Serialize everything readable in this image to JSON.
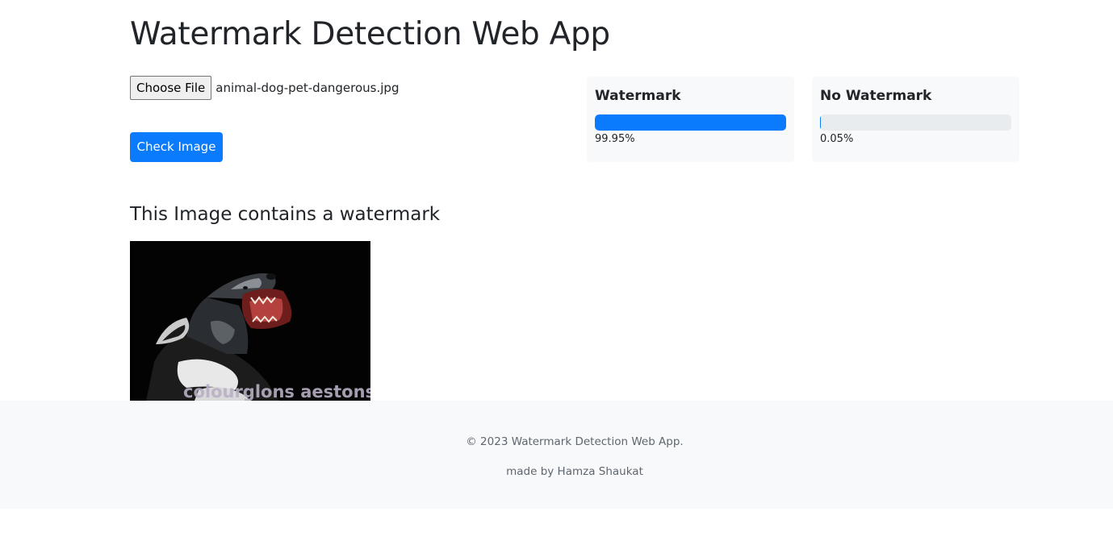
{
  "header": {
    "title": "Watermark Detection Web App"
  },
  "upload": {
    "choose_file_label": "Choose File",
    "selected_file": "animal-dog-pet-dangerous.jpg",
    "check_button_label": "Check Image"
  },
  "results": {
    "watermark": {
      "label": "Watermark",
      "percent_text": "99.95%",
      "value": 99.95
    },
    "no_watermark": {
      "label": "No Watermark",
      "percent_text": "0.05%",
      "value": 0.05
    },
    "accent_color": "#0b7bfe"
  },
  "verdict": {
    "heading": "This Image contains a watermark"
  },
  "preview": {
    "watermark_text": "colourglons aestons"
  },
  "footer": {
    "copyright": "© 2023 Watermark Detection Web App.",
    "credit": "made by Hamza Shaukat"
  }
}
